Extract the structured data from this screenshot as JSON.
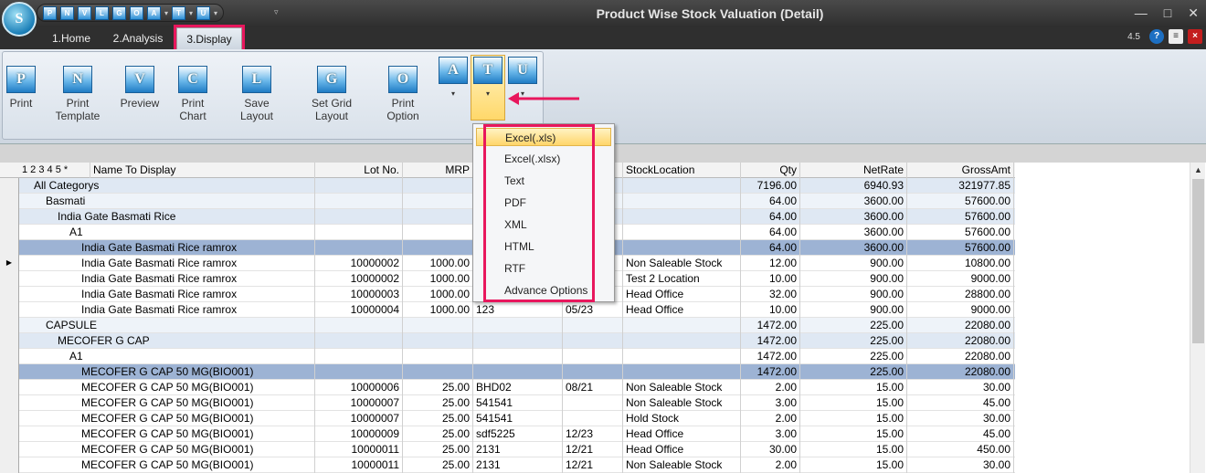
{
  "window": {
    "title": "Product Wise Stock Valuation (Detail)",
    "logo_letter": "S",
    "version": "4.5",
    "controls": [
      "—",
      "□",
      "✕"
    ],
    "quick_access": [
      "P",
      "N",
      "V",
      "L",
      "G",
      "O",
      "A",
      "T",
      "U"
    ]
  },
  "tabs": [
    {
      "label": "1.Home"
    },
    {
      "label": "2.Analysis"
    },
    {
      "label": "3.Display"
    }
  ],
  "ribbon": {
    "buttons": [
      {
        "label": "Print",
        "letter": "P"
      },
      {
        "label": "Print Template",
        "letter": "N"
      },
      {
        "label": "Preview",
        "letter": "V"
      },
      {
        "label": "Print Chart",
        "letter": "C"
      },
      {
        "label": "Save Layout",
        "letter": "L"
      },
      {
        "label": "Set Grid Layout",
        "letter": "G"
      },
      {
        "label": "Print Option",
        "letter": "O"
      }
    ],
    "small_buttons": [
      {
        "letter": "A",
        "dropdown": "▾"
      },
      {
        "letter": "T",
        "dropdown": "▾"
      },
      {
        "letter": "U",
        "dropdown": "▾"
      }
    ]
  },
  "export_menu": {
    "items": [
      "Excel(.xls)",
      "Excel(.xlsx)",
      "Text",
      "PDF",
      "XML",
      "HTML",
      "RTF",
      "Advance Options"
    ],
    "hovered": "Excel(.xls)"
  },
  "grid": {
    "level_header": "1 2 3 4 5 *",
    "columns": [
      "Name To Display",
      "Lot No.",
      "MRP",
      "",
      "",
      "StockLocation",
      "Qty",
      "NetRate",
      "GrossAmt"
    ],
    "rows": [
      {
        "name": "All Categorys",
        "lot": "",
        "mrp": "",
        "batch": "",
        "exp": "",
        "loc": "",
        "qty": "7196.00",
        "rate": "6940.93",
        "amt": "321977.85",
        "level": "g1",
        "indent": 0
      },
      {
        "name": "Basmati",
        "lot": "",
        "mrp": "",
        "batch": "",
        "exp": "",
        "loc": "",
        "qty": "64.00",
        "rate": "3600.00",
        "amt": "57600.00",
        "level": "g4",
        "indent": 1
      },
      {
        "name": "India Gate Basmati Rice",
        "lot": "",
        "mrp": "",
        "batch": "",
        "exp": "",
        "loc": "",
        "qty": "64.00",
        "rate": "3600.00",
        "amt": "57600.00",
        "level": "g3",
        "indent": 2
      },
      {
        "name": "A1",
        "lot": "",
        "mrp": "",
        "batch": "",
        "exp": "",
        "loc": "",
        "qty": "64.00",
        "rate": "3600.00",
        "amt": "57600.00",
        "level": "",
        "indent": 3
      },
      {
        "name": "India Gate Basmati Rice ramrox",
        "lot": "",
        "mrp": "",
        "batch": "",
        "exp": "",
        "loc": "",
        "qty": "64.00",
        "rate": "3600.00",
        "amt": "57600.00",
        "level": "sel",
        "indent": 4
      },
      {
        "name": "India Gate Basmati Rice ramrox",
        "lot": "10000002",
        "mrp": "1000.00",
        "batch": "",
        "exp": "",
        "loc": "Non Saleable Stock",
        "qty": "12.00",
        "rate": "900.00",
        "amt": "10800.00",
        "level": "",
        "indent": 4,
        "current": true
      },
      {
        "name": "India Gate Basmati Rice ramrox",
        "lot": "10000002",
        "mrp": "1000.00",
        "batch": "",
        "exp": "",
        "loc": "Test 2 Location",
        "qty": "10.00",
        "rate": "900.00",
        "amt": "9000.00",
        "level": "",
        "indent": 4
      },
      {
        "name": "India Gate Basmati Rice ramrox",
        "lot": "10000003",
        "mrp": "1000.00",
        "batch": "",
        "exp": "",
        "loc": "Head Office",
        "qty": "32.00",
        "rate": "900.00",
        "amt": "28800.00",
        "level": "",
        "indent": 4
      },
      {
        "name": "India Gate Basmati Rice ramrox",
        "lot": "10000004",
        "mrp": "1000.00",
        "batch": "123",
        "exp": "05/23",
        "loc": "Head Office",
        "qty": "10.00",
        "rate": "900.00",
        "amt": "9000.00",
        "level": "",
        "indent": 4
      },
      {
        "name": "CAPSULE",
        "lot": "",
        "mrp": "",
        "batch": "",
        "exp": "",
        "loc": "",
        "qty": "1472.00",
        "rate": "225.00",
        "amt": "22080.00",
        "level": "g4",
        "indent": 1
      },
      {
        "name": "MECOFER G CAP",
        "lot": "",
        "mrp": "",
        "batch": "",
        "exp": "",
        "loc": "",
        "qty": "1472.00",
        "rate": "225.00",
        "amt": "22080.00",
        "level": "g3",
        "indent": 2
      },
      {
        "name": "A1",
        "lot": "",
        "mrp": "",
        "batch": "",
        "exp": "",
        "loc": "",
        "qty": "1472.00",
        "rate": "225.00",
        "amt": "22080.00",
        "level": "",
        "indent": 3
      },
      {
        "name": "MECOFER G CAP 50 MG(BIO001)",
        "lot": "",
        "mrp": "",
        "batch": "",
        "exp": "",
        "loc": "",
        "qty": "1472.00",
        "rate": "225.00",
        "amt": "22080.00",
        "level": "sel",
        "indent": 4
      },
      {
        "name": "MECOFER G CAP 50 MG(BIO001)",
        "lot": "10000006",
        "mrp": "25.00",
        "batch": "BHD02",
        "exp": "08/21",
        "loc": "Non Saleable Stock",
        "qty": "2.00",
        "rate": "15.00",
        "amt": "30.00",
        "level": "",
        "indent": 4
      },
      {
        "name": "MECOFER G CAP 50 MG(BIO001)",
        "lot": "10000007",
        "mrp": "25.00",
        "batch": "541541",
        "exp": "",
        "loc": "Non Saleable Stock",
        "qty": "3.00",
        "rate": "15.00",
        "amt": "45.00",
        "level": "",
        "indent": 4
      },
      {
        "name": "MECOFER G CAP 50 MG(BIO001)",
        "lot": "10000007",
        "mrp": "25.00",
        "batch": "541541",
        "exp": "",
        "loc": "Hold Stock",
        "qty": "2.00",
        "rate": "15.00",
        "amt": "30.00",
        "level": "",
        "indent": 4
      },
      {
        "name": "MECOFER G CAP 50 MG(BIO001)",
        "lot": "10000009",
        "mrp": "25.00",
        "batch": "sdf5225",
        "exp": "12/23",
        "loc": "Head Office",
        "qty": "3.00",
        "rate": "15.00",
        "amt": "45.00",
        "level": "",
        "indent": 4
      },
      {
        "name": "MECOFER G CAP 50 MG(BIO001)",
        "lot": "10000011",
        "mrp": "25.00",
        "batch": "2131",
        "exp": "12/21",
        "loc": "Head Office",
        "qty": "30.00",
        "rate": "15.00",
        "amt": "450.00",
        "level": "",
        "indent": 4
      },
      {
        "name": "MECOFER G CAP 50 MG(BIO001)",
        "lot": "10000011",
        "mrp": "25.00",
        "batch": "2131",
        "exp": "12/21",
        "loc": "Non Saleable Stock",
        "qty": "2.00",
        "rate": "15.00",
        "amt": "30.00",
        "level": "",
        "indent": 4
      }
    ]
  }
}
